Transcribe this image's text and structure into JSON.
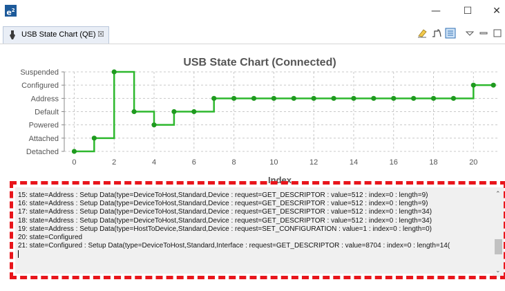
{
  "window": {
    "logo_text": "e",
    "logo_sup": "2",
    "minimize": "—",
    "maximize": "☐",
    "close": "✕"
  },
  "tab": {
    "title": "USB State Chart (QE)",
    "close_glyph": "☒"
  },
  "toolbar": {
    "icons": [
      "eraser-icon",
      "step-chart-icon",
      "list-view-icon",
      "view-menu-icon",
      "minimize-view-icon",
      "maximize-view-icon"
    ]
  },
  "chart_data": {
    "type": "line",
    "title": "USB State Chart (Connected)",
    "xlabel": "Index",
    "ylabel": "",
    "y_categories": [
      "Detached",
      "Attached",
      "Powered",
      "Default",
      "Address",
      "Configured",
      "Suspended"
    ],
    "x_ticks": [
      0,
      2,
      4,
      6,
      8,
      10,
      12,
      14,
      16,
      18,
      20
    ],
    "xlim": [
      -0.5,
      21.2
    ],
    "step": true,
    "grid": true,
    "color": "#2db82d",
    "series": [
      {
        "x": [
          0,
          1,
          2,
          3,
          4,
          5,
          6,
          7,
          8,
          9,
          10,
          11,
          12,
          13,
          14,
          15,
          16,
          17,
          18,
          19,
          20,
          21
        ],
        "y": [
          "Detached",
          "Attached",
          "Suspended",
          "Default",
          "Powered",
          "Default",
          "Default",
          "Address",
          "Address",
          "Address",
          "Address",
          "Address",
          "Address",
          "Address",
          "Address",
          "Address",
          "Address",
          "Address",
          "Address",
          "Address",
          "Configured",
          "Configured"
        ]
      }
    ]
  },
  "log": {
    "lines": [
      "15: state=Address : Setup Data(type=DeviceToHost,Standard,Device : request=GET_DESCRIPTOR : value=512 : index=0 : length=9)",
      "16: state=Address : Setup Data(type=DeviceToHost,Standard,Device : request=GET_DESCRIPTOR : value=512 : index=0 : length=9)",
      "17: state=Address : Setup Data(type=DeviceToHost,Standard,Device : request=GET_DESCRIPTOR : value=512 : index=0 : length=34)",
      "18: state=Address : Setup Data(type=DeviceToHost,Standard,Device : request=GET_DESCRIPTOR : value=512 : index=0 : length=34)",
      "19: state=Address : Setup Data(type=HostToDevice,Standard,Device : request=SET_CONFIGURATION : value=1 : index=0 : length=0)",
      "20: state=Configured",
      "21: state=Configured : Setup Data(type=DeviceToHost,Standard,Interface : request=GET_DESCRIPTOR : value=8704 : index=0 : length=14("
    ]
  },
  "colors": {
    "series": "#2db82d",
    "highlight": "#e8151b",
    "grid": "#c8c8c8",
    "title": "#555555"
  }
}
